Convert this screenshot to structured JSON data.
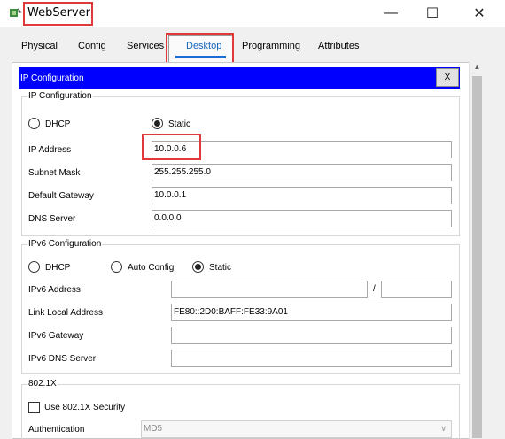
{
  "window": {
    "title": "WebServer",
    "minimize_icon": "minimize-icon",
    "maximize_icon": "maximize-icon",
    "close_icon": "close-icon",
    "min_glyph": "—",
    "max_glyph": "☐",
    "close_glyph": "✕"
  },
  "tabs": [
    {
      "label": "Physical"
    },
    {
      "label": "Config"
    },
    {
      "label": "Services"
    },
    {
      "label": "Desktop",
      "active": true
    },
    {
      "label": "Programming"
    },
    {
      "label": "Attributes"
    }
  ],
  "ip_config_window": {
    "title": "IP Configuration",
    "close_label": "X"
  },
  "ipv4": {
    "group_title": "IP Configuration",
    "dhcp_label": "DHCP",
    "static_label": "Static",
    "selected_mode": "Static",
    "ip_address_label": "IP Address",
    "ip_address": "10.0.0.6",
    "subnet_mask_label": "Subnet Mask",
    "subnet_mask": "255.255.255.0",
    "default_gateway_label": "Default Gateway",
    "default_gateway": "10.0.0.1",
    "dns_server_label": "DNS Server",
    "dns_server": "0.0.0.0"
  },
  "ipv6": {
    "group_title": "IPv6 Configuration",
    "dhcp_label": "DHCP",
    "auto_config_label": "Auto Config",
    "static_label": "Static",
    "selected_mode": "Static",
    "address_label": "IPv6 Address",
    "address": "",
    "prefix_separator": "/",
    "prefix_length": "",
    "link_local_label": "Link Local Address",
    "link_local": "FE80::2D0:BAFF:FE33:9A01",
    "gateway_label": "IPv6 Gateway",
    "gateway": "",
    "dns_label": "IPv6 DNS Server",
    "dns": ""
  },
  "dot1x": {
    "group_title": "802.1X",
    "use_security_label": "Use 802.1X Security",
    "use_security_checked": false,
    "authentication_label": "Authentication",
    "authentication_value": "MD5"
  },
  "colors": {
    "highlight_box": "#e0393b",
    "header_blue": "#0000ff",
    "active_tab": "#1a6ed8"
  }
}
